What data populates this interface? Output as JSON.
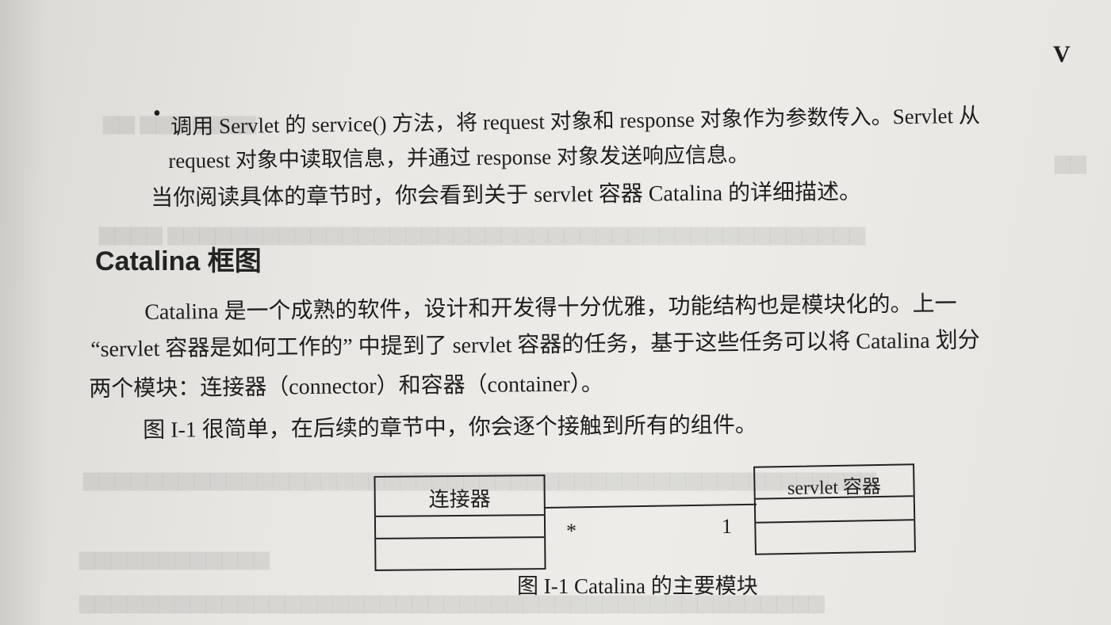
{
  "page_number": "V",
  "bullet_symbol": "•",
  "bullet_text_line1": "调用 Servlet 的 service() 方法，将 request 对象和 response 对象作为参数传入。Servlet 从",
  "bullet_text_line2": "request 对象中读取信息，并通过 response 对象发送响应信息。",
  "para_intro": "当你阅读具体的章节时，你会看到关于 servlet 容器 Catalina 的详细描述。",
  "section_heading": "Catalina 框图",
  "para_body_line1": "Catalina 是一个成熟的软件，设计和开发得十分优雅，功能结构也是模块化的。上一",
  "para_body_line2": "“servlet 容器是如何工作的” 中提到了 servlet 容器的任务，基于这些任务可以将 Catalina 划分",
  "para_body_line3": "两个模块：连接器（connector）和容器（container）。",
  "para_figure_ref": "图 I-1 很简单，在后续的章节中，你会逐个接触到所有的组件。",
  "diagram": {
    "left_box_label": "连接器",
    "right_box_label": "servlet 容器",
    "left_multiplicity": "*",
    "right_multiplicity": "1"
  },
  "figure_caption": "图 I-1  Catalina 的主要模块"
}
